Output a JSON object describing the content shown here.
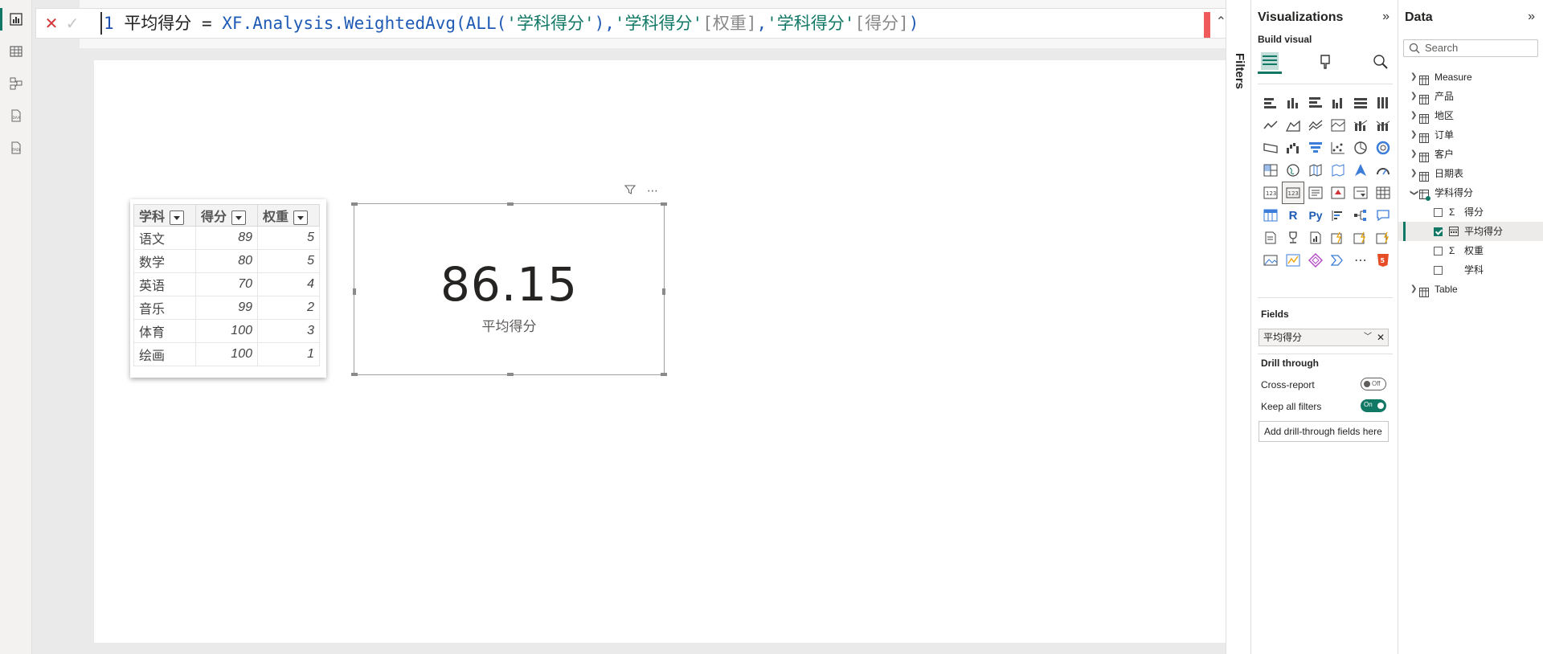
{
  "formula": {
    "line_no": "1",
    "measure_name": "平均得分",
    "op": "=",
    "fn": "XF.Analysis.WeightedAvg(ALL(",
    "arg1": "'学科得分'",
    "close1": "),",
    "tbl2": "'学科得分'",
    "col2": "[权重]",
    "comma": ",",
    "tbl3": "'学科得分'",
    "col3": "[得分]",
    "close2": ")"
  },
  "filters_label": "Filters",
  "table": {
    "headers": [
      "学科",
      "得分",
      "权重"
    ],
    "rows": [
      [
        "语文",
        "89",
        "5"
      ],
      [
        "数学",
        "80",
        "5"
      ],
      [
        "英语",
        "70",
        "4"
      ],
      [
        "音乐",
        "99",
        "2"
      ],
      [
        "体育",
        "100",
        "3"
      ],
      [
        "绘画",
        "100",
        "1"
      ]
    ]
  },
  "card": {
    "value": "86.15",
    "label": "平均得分"
  },
  "visualizations": {
    "title": "Visualizations",
    "build_visual": "Build visual",
    "fields_label": "Fields",
    "field_value": "平均得分",
    "drill_title": "Drill through",
    "cross_report": "Cross-report",
    "cross_report_state": "Off",
    "keep_filters": "Keep all filters",
    "keep_filters_state": "On",
    "add_drill": "Add drill-through fields here"
  },
  "data_pane": {
    "title": "Data",
    "search_placeholder": "Search",
    "tables": [
      "Measure",
      "产品",
      "地区",
      "订单",
      "客户",
      "日期表"
    ],
    "expanded_table": "学科得分",
    "fields": [
      {
        "label": "得分",
        "icon": "Σ",
        "checked": false
      },
      {
        "label": "平均得分",
        "icon": "calc",
        "checked": true
      },
      {
        "label": "权重",
        "icon": "Σ",
        "checked": false
      },
      {
        "label": "学科",
        "icon": "",
        "checked": false
      }
    ],
    "last_table": "Table"
  },
  "colors": {
    "accent": "#117865",
    "error": "#d13438"
  }
}
